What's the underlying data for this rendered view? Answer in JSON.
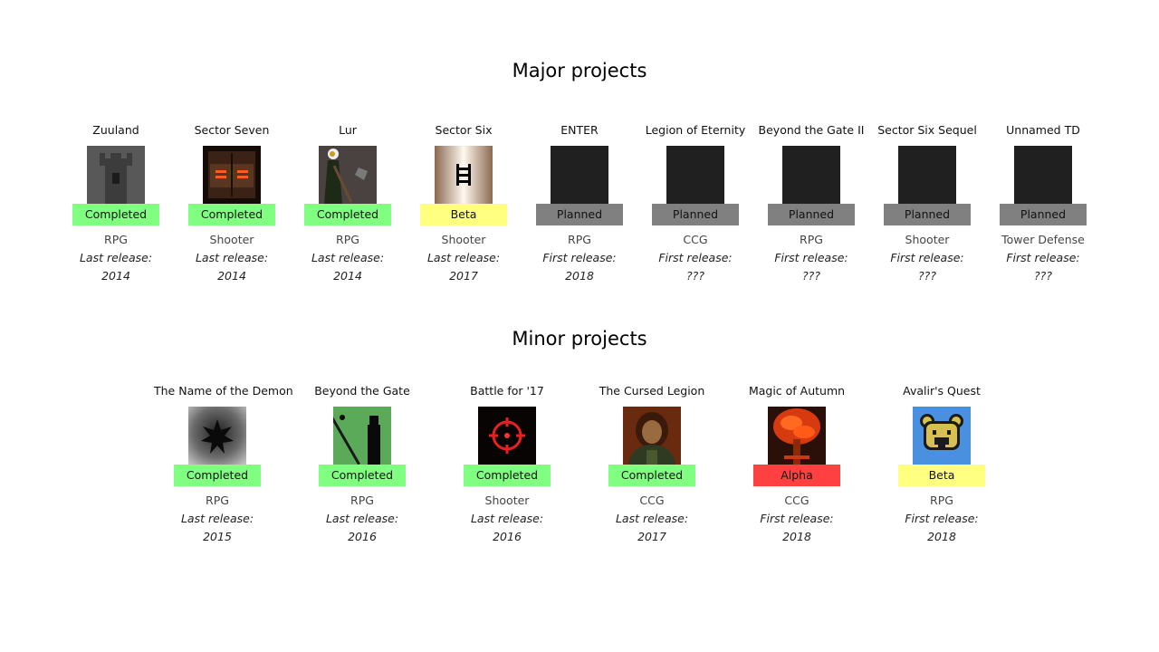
{
  "sections": {
    "major": {
      "title": "Major projects"
    },
    "minor": {
      "title": "Minor projects"
    }
  },
  "status_colors": {
    "Completed": "#80ff80",
    "Beta": "#ffff80",
    "Planned": "#808080",
    "Alpha": "#ff4040"
  },
  "major": [
    {
      "name": "Zuuland",
      "status": "Completed",
      "genre": "RPG",
      "release_label": "Last release:",
      "release_year": "2014",
      "thumb_icon": "tower-icon"
    },
    {
      "name": "Sector Seven",
      "status": "Completed",
      "genre": "Shooter",
      "release_label": "Last release:",
      "release_year": "2014",
      "thumb_icon": "door-icon"
    },
    {
      "name": "Lur",
      "status": "Completed",
      "genre": "RPG",
      "release_label": "Last release:",
      "release_year": "2014",
      "thumb_icon": "axe-warrior-icon"
    },
    {
      "name": "Sector Six",
      "status": "Beta",
      "genre": "Shooter",
      "release_label": "Last release:",
      "release_year": "2017",
      "thumb_icon": "ladder-icon"
    },
    {
      "name": "ENTER",
      "status": "Planned",
      "genre": "RPG",
      "release_label": "First release:",
      "release_year": "2018",
      "thumb_icon": "placeholder-icon"
    },
    {
      "name": "Legion of Eternity",
      "status": "Planned",
      "genre": "CCG",
      "release_label": "First release:",
      "release_year": "???",
      "thumb_icon": "placeholder-icon"
    },
    {
      "name": "Beyond the Gate II",
      "status": "Planned",
      "genre": "RPG",
      "release_label": "First release:",
      "release_year": "???",
      "thumb_icon": "placeholder-icon"
    },
    {
      "name": "Sector Six Sequel",
      "status": "Planned",
      "genre": "Shooter",
      "release_label": "First release:",
      "release_year": "???",
      "thumb_icon": "placeholder-icon"
    },
    {
      "name": "Unnamed TD",
      "status": "Planned",
      "genre": "Tower Defense",
      "release_label": "First release:",
      "release_year": "???",
      "thumb_icon": "placeholder-icon"
    }
  ],
  "minor": [
    {
      "name": "The Name of the Demon",
      "status": "Completed",
      "genre": "RPG",
      "release_label": "Last release:",
      "release_year": "2015",
      "thumb_icon": "dark-star-icon"
    },
    {
      "name": "Beyond the Gate",
      "status": "Completed",
      "genre": "RPG",
      "release_label": "Last release:",
      "release_year": "2016",
      "thumb_icon": "staff-figure-icon"
    },
    {
      "name": "Battle for '17",
      "status": "Completed",
      "genre": "Shooter",
      "release_label": "Last release:",
      "release_year": "2016",
      "thumb_icon": "crosshair-icon"
    },
    {
      "name": "The Cursed Legion",
      "status": "Completed",
      "genre": "CCG",
      "release_label": "Last release:",
      "release_year": "2017",
      "thumb_icon": "knight-portrait-icon"
    },
    {
      "name": "Magic of Autumn",
      "status": "Alpha",
      "genre": "CCG",
      "release_label": "First release:",
      "release_year": "2018",
      "thumb_icon": "autumn-tree-icon"
    },
    {
      "name": "Avalir's Quest",
      "status": "Beta",
      "genre": "RPG",
      "release_label": "First release:",
      "release_year": "2018",
      "thumb_icon": "bear-face-icon"
    }
  ]
}
